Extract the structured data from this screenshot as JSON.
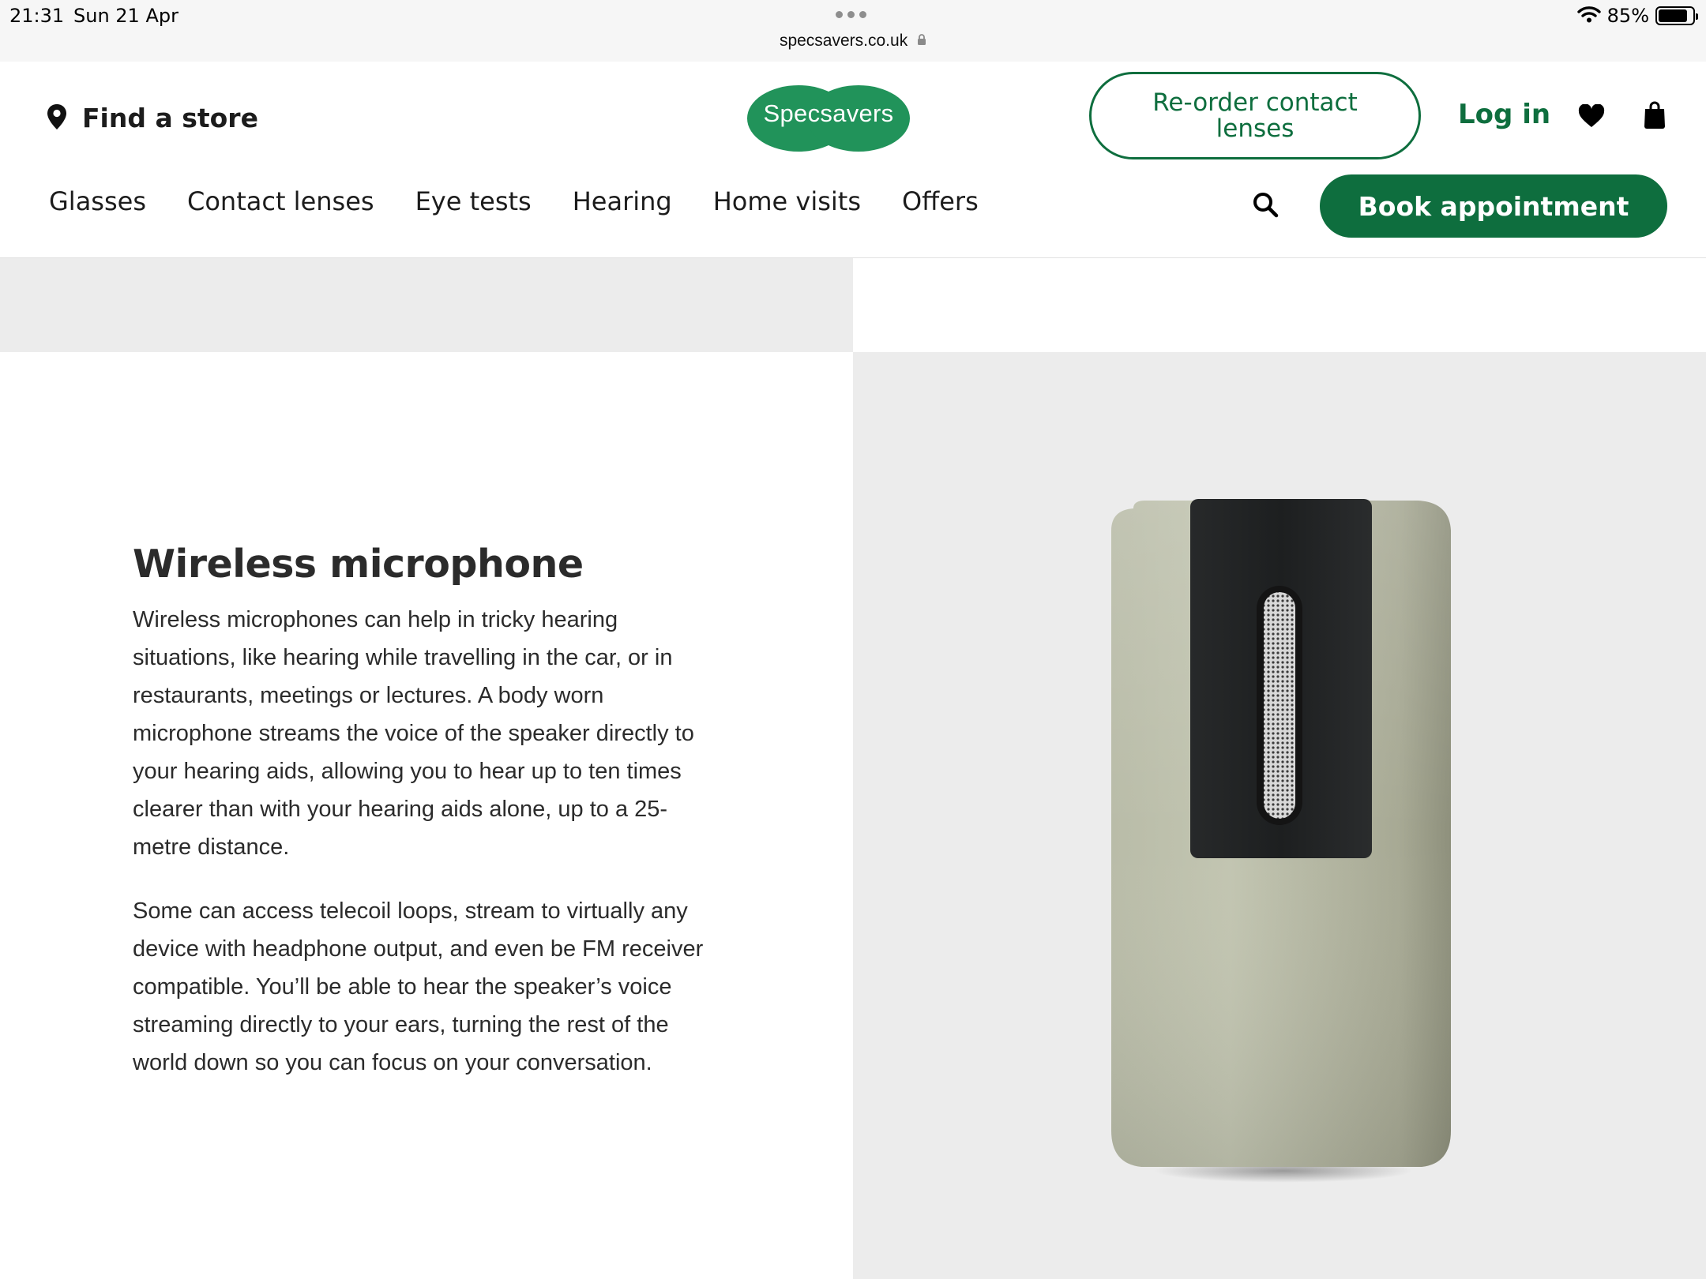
{
  "status_bar": {
    "time": "21:31",
    "date": "Sun 21 Apr",
    "url": "specsavers.co.uk",
    "battery": "85%",
    "battery_level": 0.85
  },
  "header": {
    "find_store": "Find a store",
    "logo": "Specsavers",
    "reorder": "Re-order contact lenses",
    "login": "Log in",
    "book": "Book appointment"
  },
  "nav": {
    "items": [
      "Glasses",
      "Contact lenses",
      "Eye tests",
      "Hearing",
      "Home visits",
      "Offers"
    ]
  },
  "content": {
    "heading": "Wireless microphone",
    "paragraphs": [
      "Wireless microphones can help in tricky hearing situations, like hearing while travelling in the car, or in restaurants, meetings or lectures. A body worn microphone streams the voice of the speaker directly to your hearing aids, allowing you to hear up to ten times clearer than with your hearing aids alone, up to a 25-metre distance.",
      "Some can access telecoil loops, stream to virtually any device with headphone output, and even be FM receiver compatible. You’ll be able to hear the speaker’s voice streaming directly to your ears, turning the rest of the world down so you can focus on your conversation."
    ]
  },
  "colors": {
    "brand_green": "#21935a",
    "dark_green": "#0e6e3e",
    "panel_grey": "#ececec"
  },
  "icons": [
    "location-pin-icon",
    "heart-icon",
    "shopping-bag-icon",
    "search-icon",
    "lock-icon",
    "wifi-icon",
    "battery-icon",
    "more-dots-icon"
  ]
}
